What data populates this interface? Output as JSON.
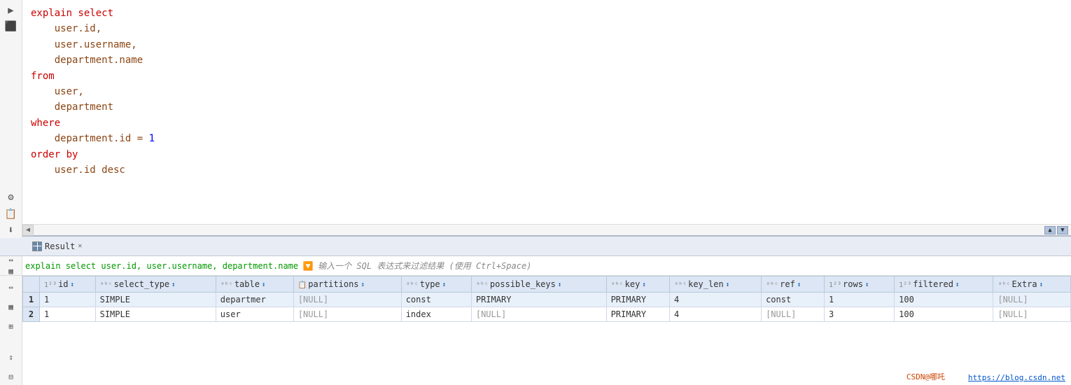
{
  "editor": {
    "lines": [
      {
        "tokens": [
          {
            "text": "explain select",
            "class": "kw"
          }
        ]
      },
      {
        "tokens": [
          {
            "text": "    user.id,",
            "class": "col"
          }
        ]
      },
      {
        "tokens": [
          {
            "text": "    user.username,",
            "class": "col"
          }
        ]
      },
      {
        "tokens": [
          {
            "text": "    department.name",
            "class": "col"
          }
        ]
      },
      {
        "tokens": [
          {
            "text": "from",
            "class": "kw"
          }
        ]
      },
      {
        "tokens": [
          {
            "text": "    user,",
            "class": "col"
          }
        ]
      },
      {
        "tokens": [
          {
            "text": "    department",
            "class": "col"
          }
        ]
      },
      {
        "tokens": [
          {
            "text": "where",
            "class": "kw"
          }
        ]
      },
      {
        "tokens": [
          {
            "text": "    department.id = ",
            "class": "col"
          },
          {
            "text": "1",
            "class": "num"
          }
        ]
      },
      {
        "tokens": [
          {
            "text": "order by",
            "class": "kw"
          }
        ]
      },
      {
        "tokens": [
          {
            "text": "    user.id desc",
            "class": "col"
          }
        ]
      }
    ]
  },
  "result": {
    "tab_label": "Result",
    "filter_sql": "explain select user.id, user.username, department.name",
    "filter_placeholder": "输入一个 SQL 表达式来过滤结果 (使用 Ctrl+Space)",
    "columns": [
      {
        "name": "id",
        "type": "123"
      },
      {
        "name": "select_type",
        "type": "ABC"
      },
      {
        "name": "table",
        "type": "ABC"
      },
      {
        "name": "partitions",
        "type": "ABC"
      },
      {
        "name": "type",
        "type": "ABC"
      },
      {
        "name": "possible_keys",
        "type": "ABC"
      },
      {
        "name": "key",
        "type": "ABC"
      },
      {
        "name": "key_len",
        "type": "ABC"
      },
      {
        "name": "ref",
        "type": "ABC"
      },
      {
        "name": "rows",
        "type": "123"
      },
      {
        "name": "filtered",
        "type": "123"
      },
      {
        "name": "Extra",
        "type": "ABC"
      }
    ],
    "rows": [
      {
        "rownum": "1",
        "id": "1",
        "select_type": "SIMPLE",
        "table": "departmer",
        "partitions": "[NULL]",
        "type": "const",
        "possible_keys": "PRIMARY",
        "key": "PRIMARY",
        "key_len": "4",
        "ref": "const",
        "rows": "1",
        "filtered": "100",
        "extra": "[NULL]"
      },
      {
        "rownum": "2",
        "id": "1",
        "select_type": "SIMPLE",
        "table": "user",
        "partitions": "[NULL]",
        "type": "index",
        "possible_keys": "[NULL]",
        "key": "PRIMARY",
        "key_len": "4",
        "ref": "[NULL]",
        "rows": "3",
        "filtered": "100",
        "extra": "[NULL]"
      }
    ]
  },
  "icons": {
    "toolbar_run": "▶",
    "toolbar_settings": "⚙",
    "toolbar_file": "📄",
    "toolbar_download": "⬇",
    "scroll_left": "◀",
    "nav_up": "▲",
    "nav_down": "▼",
    "close": "✕",
    "sort": "↕"
  },
  "watermark": {
    "site": "https://blog.csdn.net",
    "author": "CSDN@哪吒"
  }
}
